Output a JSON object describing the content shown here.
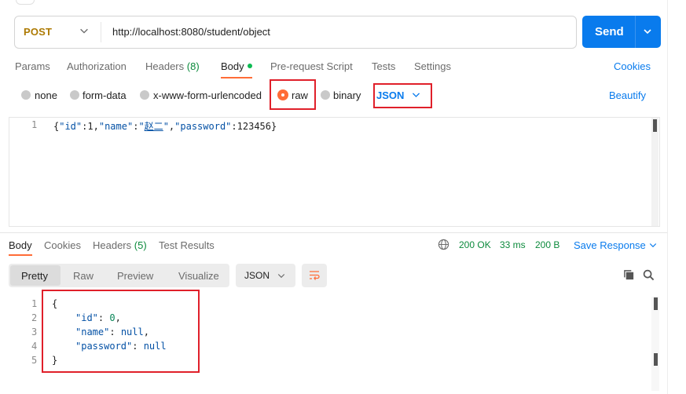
{
  "request": {
    "method": "POST",
    "url": "http://localhost:8080/student/object",
    "send_label": "Send"
  },
  "request_tabs": {
    "params": "Params",
    "authorization": "Authorization",
    "headers": "Headers",
    "headers_count": "(8)",
    "body": "Body",
    "pre_request": "Pre-request Script",
    "tests": "Tests",
    "settings": "Settings",
    "cookies": "Cookies"
  },
  "body_types": {
    "none": "none",
    "form_data": "form-data",
    "urlencoded": "x-www-form-urlencoded",
    "raw": "raw",
    "binary": "binary",
    "selected_format": "JSON",
    "beautify": "Beautify"
  },
  "request_body": {
    "line_numbers": [
      "1"
    ],
    "brace_open": "{",
    "k_id": "\"id\"",
    "colon1": ":",
    "v_id": "1",
    "comma1": ",",
    "k_name": "\"name\"",
    "colon2": ":",
    "v_name_q1": "\"",
    "v_name": "赵二",
    "v_name_q2": "\"",
    "comma2": ",",
    "k_password": "\"password\"",
    "colon3": ":",
    "v_password": "123456",
    "brace_close": "}"
  },
  "response_tabs": {
    "body": "Body",
    "cookies": "Cookies",
    "headers": "Headers",
    "headers_count": "(5)",
    "test_results": "Test Results"
  },
  "response_status": {
    "status": "200 OK",
    "time": "33 ms",
    "size": "200 B",
    "save_response": "Save Response"
  },
  "response_view": {
    "pretty": "Pretty",
    "raw": "Raw",
    "preview": "Preview",
    "visualize": "Visualize",
    "format": "JSON"
  },
  "response_body": {
    "line_numbers": [
      "1",
      "2",
      "3",
      "4",
      "5"
    ],
    "brace_open": "{",
    "k_id": "\"id\"",
    "v_id": "0",
    "k_name": "\"name\"",
    "v_name": "null",
    "k_password": "\"password\"",
    "v_password": "null",
    "brace_close": "}"
  },
  "colors": {
    "accent": "#ff6c37",
    "primary": "#097bed",
    "highlight_box": "#e0202a",
    "status_ok": "#0c8a3c"
  },
  "icons": [
    "chevron-down-icon",
    "globe-icon",
    "wrap-lines-icon",
    "copy-icon",
    "search-icon"
  ]
}
